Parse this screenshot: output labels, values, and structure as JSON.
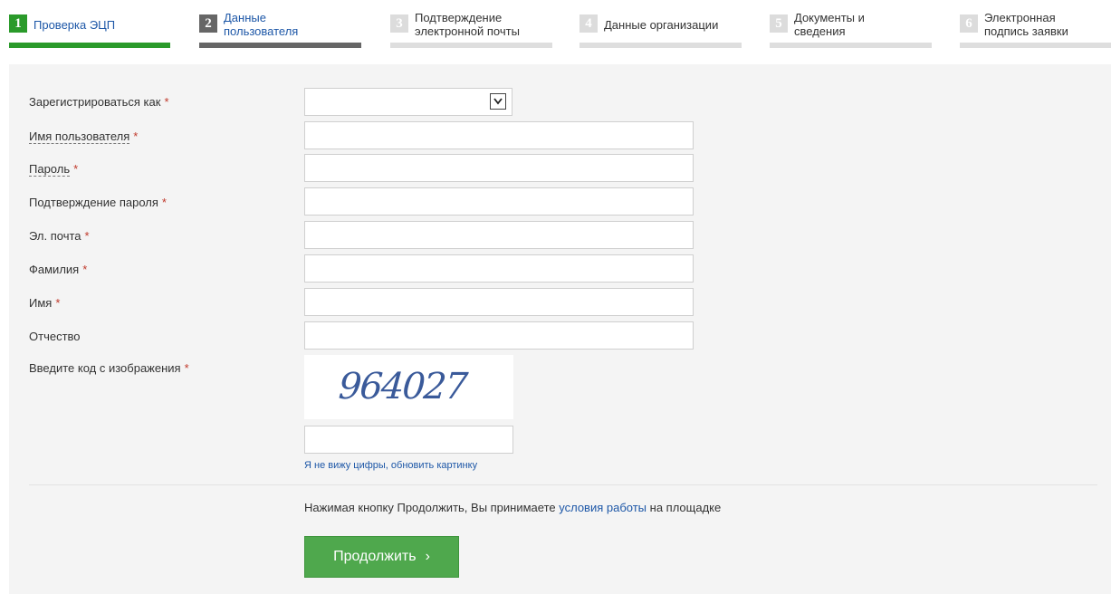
{
  "steps": [
    {
      "num": "1",
      "label": "Проверка ЭЦП"
    },
    {
      "num": "2",
      "label_line1": "Данные",
      "label_line2": "пользователя"
    },
    {
      "num": "3",
      "label_line1": "Подтверждение",
      "label_line2": "электронной почты"
    },
    {
      "num": "4",
      "label": "Данные организации"
    },
    {
      "num": "5",
      "label_line1": "Документы и",
      "label_line2": "сведения"
    },
    {
      "num": "6",
      "label_line1": "Электронная",
      "label_line2": "подпись заявки"
    }
  ],
  "form": {
    "register_as": {
      "label": "Зарегистрироваться как",
      "required": "*",
      "value": ""
    },
    "username": {
      "label": "Имя пользователя",
      "required": "*",
      "value": ""
    },
    "password": {
      "label": "Пароль",
      "required": "*",
      "value": ""
    },
    "password_confirm": {
      "label": "Подтверждение пароля",
      "required": "*",
      "value": ""
    },
    "email": {
      "label": "Эл. почта",
      "required": "*",
      "value": ""
    },
    "last_name": {
      "label": "Фамилия",
      "required": "*",
      "value": ""
    },
    "first_name": {
      "label": "Имя",
      "required": "*",
      "value": ""
    },
    "middle_name": {
      "label": "Отчество",
      "value": ""
    },
    "captcha": {
      "label": "Введите код с изображения",
      "required": "*",
      "code": "964027",
      "value": "",
      "refresh_link": "Я не вижу цифры, обновить картинку"
    }
  },
  "terms": {
    "prefix": "Нажимая кнопку Продолжить, Вы принимаете ",
    "link": "условия работы",
    "suffix": " на площадке"
  },
  "continue_button": {
    "label": "Продолжить",
    "chevron": "›"
  },
  "colors": {
    "done": "#2a9a2a",
    "current": "#666666",
    "link": "#1d57a7",
    "button": "#4fa84d",
    "required": "#c0392b"
  }
}
